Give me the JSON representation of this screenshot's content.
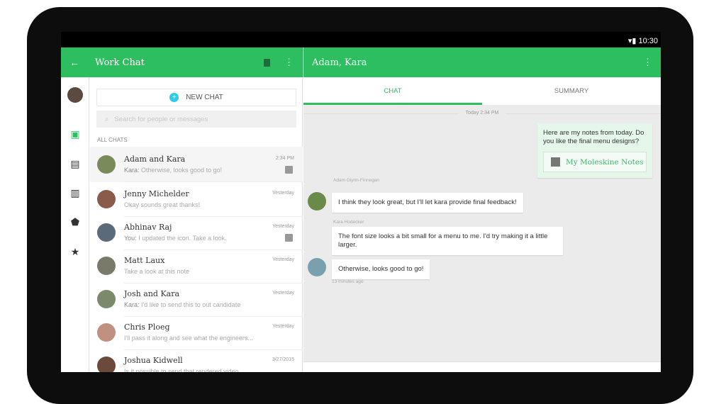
{
  "status": {
    "time": "10:30"
  },
  "left": {
    "title": "Work Chat",
    "new_chat": "NEW CHAT",
    "search_placeholder": "Search for people or messages",
    "section": "ALL CHATS",
    "chats": [
      {
        "name": "Adam and Kara",
        "sender": "Kara:",
        "preview": " Otherwise, looks good to go!",
        "time": "2:34 PM",
        "note": true
      },
      {
        "name": "Jenny Michelder",
        "sender": "",
        "preview": "Okay sounds great thanks!",
        "time": "Yesterday",
        "note": false
      },
      {
        "name": "Abhinav Raj",
        "sender": "You:",
        "preview": " I updated the icon. Take a look.",
        "time": "Yesterday",
        "note": true
      },
      {
        "name": "Matt Laux",
        "sender": "",
        "preview": "Take a look at this note",
        "time": "Yesterday",
        "note": false
      },
      {
        "name": "Josh and Kara",
        "sender": "Kara:",
        "preview": " I'd like to send this to out candidate",
        "time": "Yesterday",
        "note": false
      },
      {
        "name": "Chris Ploeg",
        "sender": "",
        "preview": "I'll pass it along and see what the engineers...",
        "time": "Yesterday",
        "note": false
      },
      {
        "name": "Joshua Kidwell",
        "sender": "",
        "preview": "Is it possible to send that rendered video",
        "time": "3/27/2015",
        "note": false
      }
    ]
  },
  "right": {
    "title": "Adam, Kara",
    "tabs": [
      "CHAT",
      "SUMMARY"
    ],
    "date": "Today 2:34 PM",
    "mine": "Here  are my notes from today. Do you like the final menu designs?",
    "note_title": "My Moleskine Notes",
    "sender1": "Adam Glynn-Finnegan",
    "msg1": "I think they look great, but I'll let kara provide final feedback!",
    "sender2": "Kara Hodecker",
    "msg2": "The font size looks a bit small for a menu to me. I'd try making it a little larger.",
    "msg3": "Otherwise, looks good to go!",
    "ago": "13 minutes ago"
  },
  "colors": {
    "accent": "#2dbe60",
    "new_chat": "#2ecbe6"
  }
}
